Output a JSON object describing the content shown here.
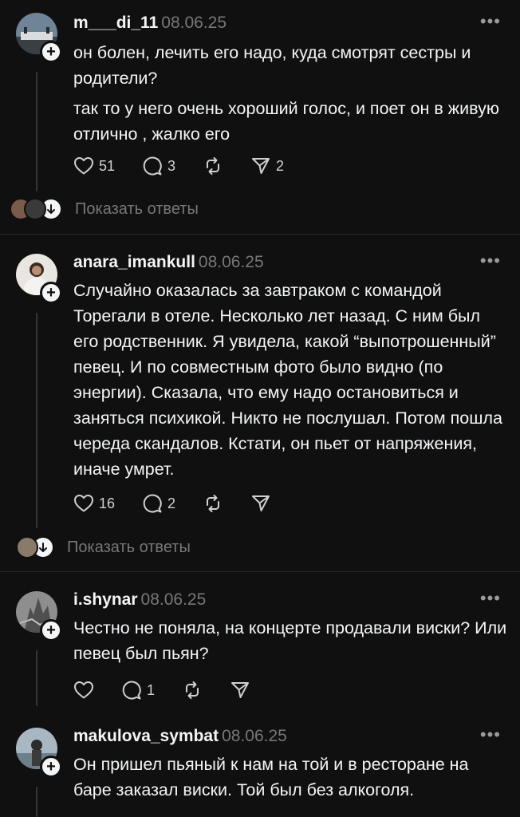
{
  "posts": [
    {
      "username": "m___di_11",
      "date": "08.06.25",
      "paragraphs": [
        "он болен, лечить его надо, куда смотрят сестры и родители?",
        "так то у него очень хороший голос, и поет он в живую отлично , жалко его"
      ],
      "likes": "51",
      "comments": "3",
      "shares": "2",
      "replies_label": "Показать ответы"
    },
    {
      "username": "anara_imankull",
      "date": "08.06.25",
      "paragraphs": [
        "Случайно оказалась за завтраком с командой Торегали в отеле. Несколько лет назад. С ним был его родственник. Я увидела, какой “выпотрошенный” певец. И по совместным фото было видно (по энергии). Сказала, что ему надо остановиться и заняться психикой. Никто не послушал. Потом пошла череда скандалов. Кстати, он пьет от напряжения, иначе умрет."
      ],
      "likes": "16",
      "comments": "2",
      "replies_label": "Показать ответы"
    },
    {
      "username": "i.shynar",
      "date": "08.06.25",
      "paragraphs": [
        "Честно не поняла, на концерте продавали виски? Или певец был пьян?"
      ],
      "comments": "1"
    },
    {
      "username": "makulova_symbat",
      "date": "08.06.25",
      "paragraphs": [
        "Он пришел пьяный к нам на той и в ресторане на баре заказал виски. Той был без алкоголя."
      ]
    }
  ],
  "more_label": "•••",
  "plus_label": "+",
  "icons": [
    "heart-icon",
    "comment-icon",
    "repost-icon",
    "share-icon",
    "plus-icon",
    "arrow-down-icon",
    "more-icon"
  ]
}
